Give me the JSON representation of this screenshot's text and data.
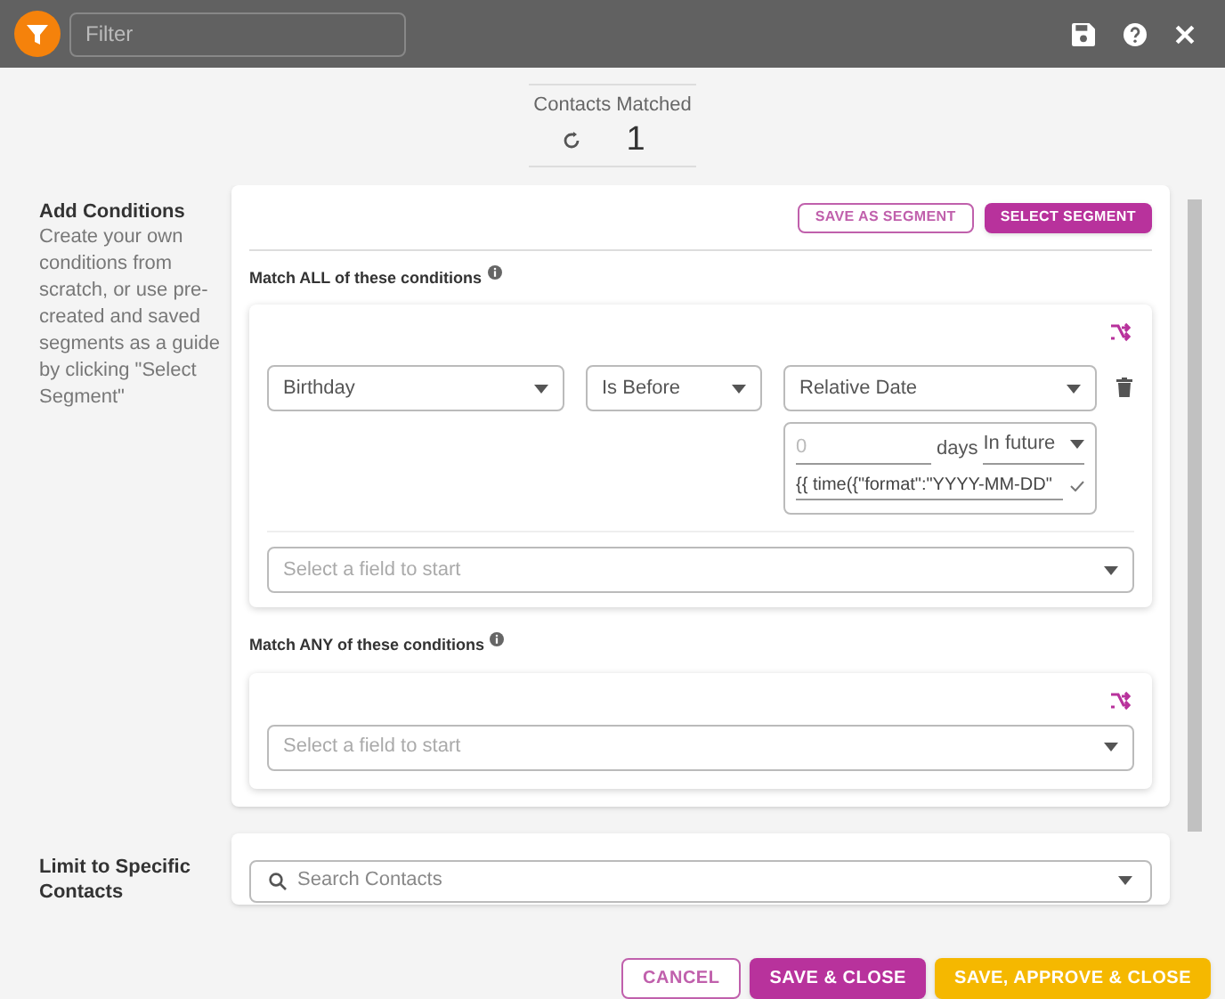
{
  "header": {
    "filter_placeholder": "Filter"
  },
  "contacts_matched": {
    "label": "Contacts Matched",
    "count": "1"
  },
  "add_conditions": {
    "title": "Add Conditions",
    "description": "Create your own conditions from scratch, or use pre-created and saved segments as a guide by clicking \"Select Segment\"",
    "buttons": [
      {
        "label": "SAVE AS SEGMENT",
        "kind": "outline"
      },
      {
        "label": "SELECT SEGMENT",
        "kind": "filled"
      }
    ]
  },
  "match_all": {
    "title": "Match ALL of these conditions",
    "conditions": [
      {
        "field": "Birthday",
        "operator": "Is Before",
        "value_type": "Relative Date",
        "amount_placeholder": "0",
        "unit": "days",
        "direction": "In future",
        "expression": "{{ time({\"format\":\"YYYY-MM-DD\""
      }
    ],
    "new_field_placeholder": "Select a field to start"
  },
  "match_any": {
    "title": "Match ANY of these conditions",
    "new_field_placeholder": "Select a field to start"
  },
  "limit": {
    "title": "Limit to Specific Contacts",
    "search_placeholder": "Search Contacts"
  },
  "footer_buttons": [
    {
      "label": "CANCEL",
      "kind": "outline"
    },
    {
      "label": "SAVE & CLOSE",
      "kind": "filled"
    },
    {
      "label": "SAVE, APPROVE & CLOSE",
      "kind": "accent"
    }
  ]
}
